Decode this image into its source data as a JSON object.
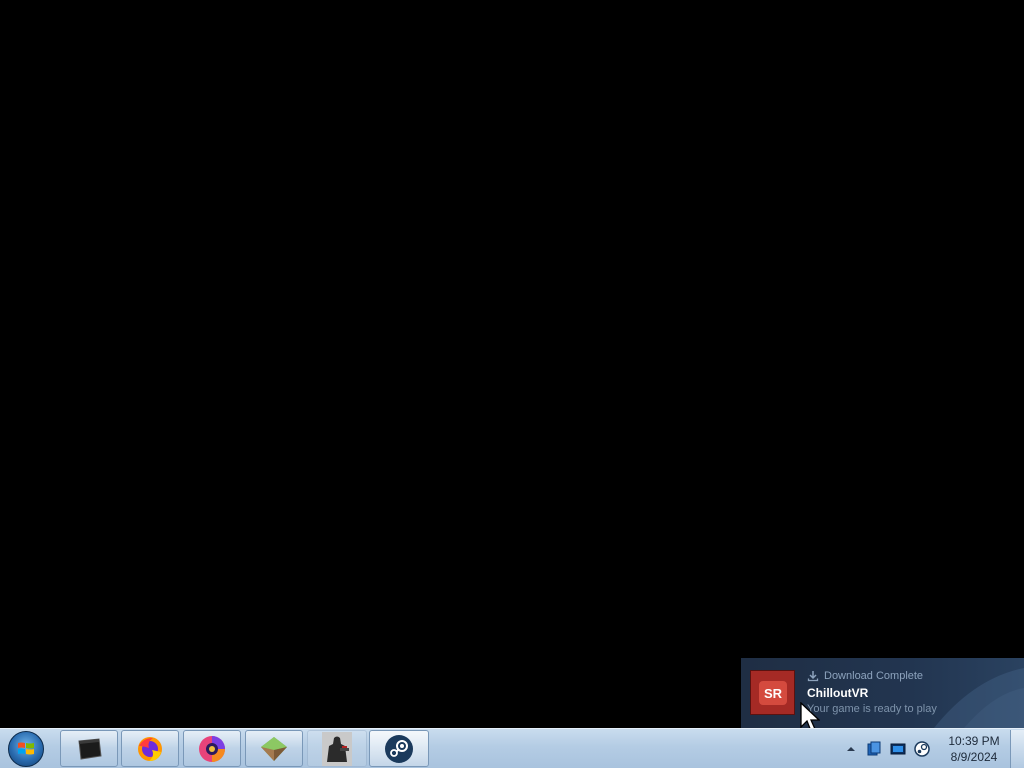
{
  "notification": {
    "header": "Download Complete",
    "header_icon": "download-icon",
    "title": "ChilloutVR",
    "message": "Your game is ready to play",
    "game_icon": "chilloutvr-icon",
    "accent": "#a52a25"
  },
  "taskbar": {
    "start_icon": "windows-start-orb",
    "pinned": [
      {
        "name": "black-window-app-icon"
      },
      {
        "name": "firefox-icon"
      },
      {
        "name": "spiral-app-icon"
      },
      {
        "name": "green-cube-app-icon"
      },
      {
        "name": "game-soldier-icon"
      },
      {
        "name": "steam-icon"
      }
    ],
    "tray": {
      "expand_icon": "tray-expand-arrow-icon",
      "icons": [
        "network-sync-icon",
        "display-icon",
        "steam-tray-icon"
      ]
    },
    "clock": {
      "time": "10:39 PM",
      "date": "8/9/2024"
    }
  },
  "colors": {
    "taskbar": "#b4cce4",
    "toast_bg": "#223550",
    "desktop": "#000000"
  }
}
